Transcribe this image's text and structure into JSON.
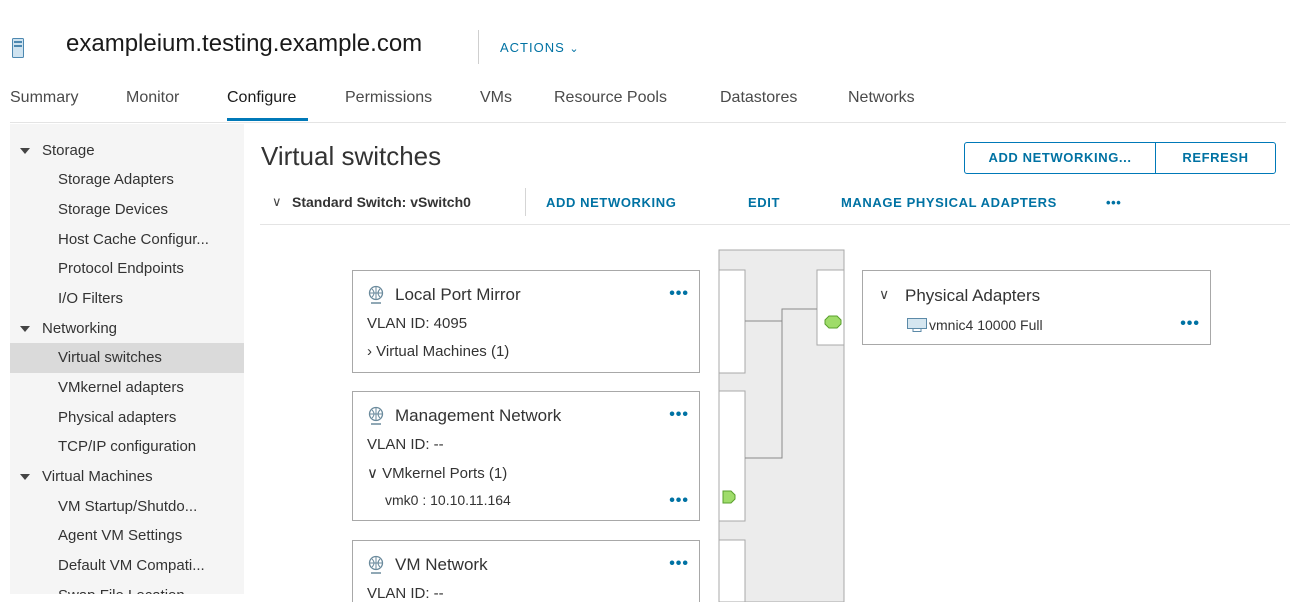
{
  "header": {
    "host_name": "exampleium.testing.example.com",
    "actions_label": "ACTIONS"
  },
  "tabs": [
    {
      "label": "Summary"
    },
    {
      "label": "Monitor"
    },
    {
      "label": "Configure",
      "active": true
    },
    {
      "label": "Permissions"
    },
    {
      "label": "VMs"
    },
    {
      "label": "Resource Pools"
    },
    {
      "label": "Datastores"
    },
    {
      "label": "Networks"
    }
  ],
  "sidebar": {
    "groups": [
      {
        "label": "Storage",
        "items": [
          "Storage Adapters",
          "Storage Devices",
          "Host Cache Configur...",
          "Protocol Endpoints",
          "I/O Filters"
        ]
      },
      {
        "label": "Networking",
        "items": [
          "Virtual switches",
          "VMkernel adapters",
          "Physical adapters",
          "TCP/IP configuration"
        ]
      },
      {
        "label": "Virtual Machines",
        "items": [
          "VM Startup/Shutdo...",
          "Agent VM Settings",
          "Default VM Compati...",
          "Swap File Location"
        ]
      }
    ],
    "selected": "Virtual switches"
  },
  "main": {
    "title": "Virtual switches",
    "add_networking_button": "ADD NETWORKING...",
    "refresh_button": "REFRESH"
  },
  "switch": {
    "name": "Standard Switch: vSwitch0",
    "links": {
      "add_networking": "ADD NETWORKING",
      "edit": "EDIT",
      "manage_adapters": "MANAGE PHYSICAL ADAPTERS",
      "more": "•••"
    }
  },
  "port_groups": [
    {
      "name": "Local Port Mirror",
      "vlan": "VLAN ID: 4095",
      "expander": "Virtual Machines (1)",
      "expanded": false
    },
    {
      "name": "Management Network",
      "vlan": "VLAN ID: --",
      "expander": "VMkernel Ports (1)",
      "expanded": true,
      "port": "vmk0 : 10.10.11.164"
    },
    {
      "name": "VM Network",
      "vlan": "VLAN ID: --"
    }
  ],
  "physical_adapters": {
    "title": "Physical Adapters",
    "nic": "vmnic4 10000 Full"
  },
  "icons": {
    "dots": "•••",
    "chevron_down": "∨",
    "chevron_right": "›"
  },
  "colors": {
    "accent": "#0072a3",
    "port_green": "#9fdc6a"
  }
}
